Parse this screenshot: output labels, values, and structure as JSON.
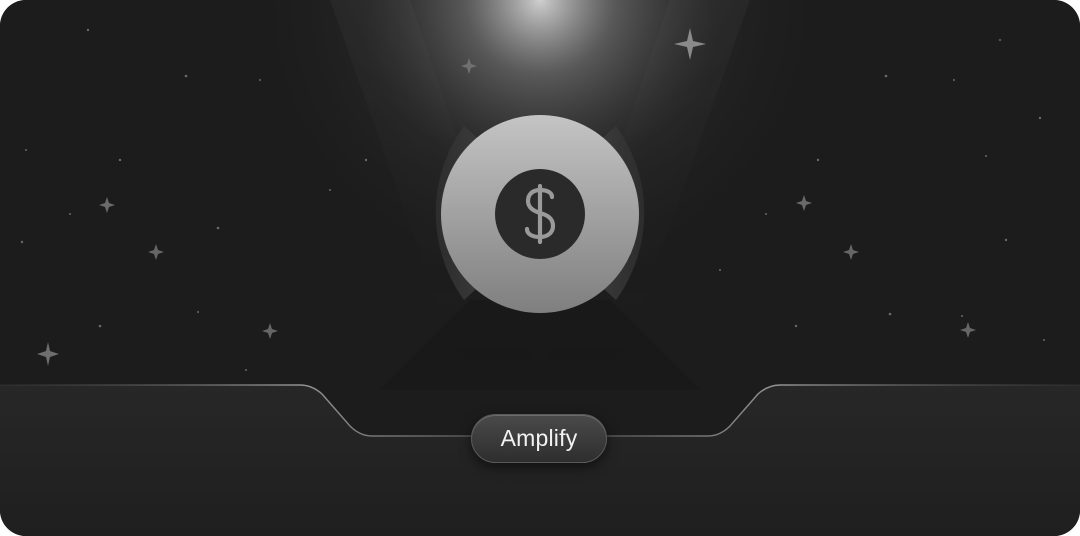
{
  "action_button": {
    "label": "Amplify"
  },
  "emblem": {
    "icon": "dollar-sign-icon"
  },
  "colors": {
    "background": "#1c1c1c",
    "panel": "#252525",
    "coin_light": "#c4c4c4",
    "coin_dark": "#7f7f7f",
    "icon_disc": "#2a2a2a",
    "icon_glyph": "#9a9a9a",
    "button_text": "#f2f2f2"
  }
}
